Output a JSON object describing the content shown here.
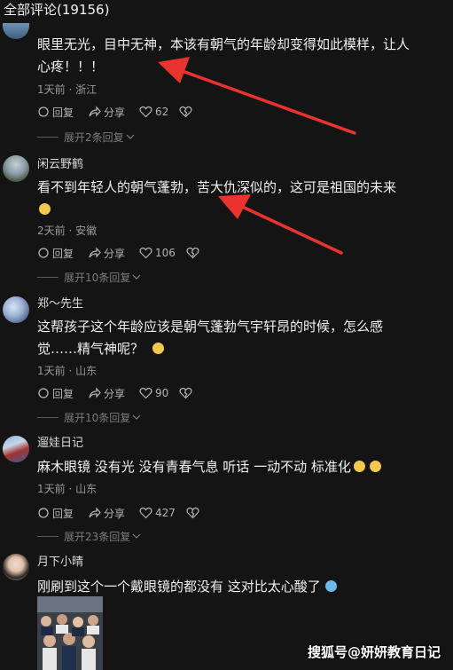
{
  "header": {
    "title": "全部评论(19156)"
  },
  "actions": {
    "reply_label": "回复",
    "share_label": "分享"
  },
  "comments": [
    {
      "username": "",
      "text_lines": [
        "眼里无光，目中无神，本该有朝气的年龄却变得如此模样，让人",
        "心疼！！！"
      ],
      "meta": "1天前 · 浙江",
      "likes": "62",
      "expand": "展开2条回复"
    },
    {
      "username": "闲云野鹤",
      "text_lines": [
        "看不到年轻人的朝气蓬勃，苦大仇深似的，这可是祖国的未来",
        ""
      ],
      "meta": "2天前 · 安徽",
      "likes": "106",
      "expand": "展开10条回复"
    },
    {
      "username": "郑～先生",
      "text_lines": [
        "这帮孩子这个年龄应该是朝气蓬勃气宇轩昂的时候，怎么感",
        "觉……精气神呢？"
      ],
      "meta": "1天前 · 山东",
      "likes": "90",
      "expand": "展开10条回复"
    },
    {
      "username": "遛娃日记",
      "text_lines": [
        "麻木眼镜 没有光 没有青春气息 听话 一动不动 标准化"
      ],
      "meta": "1天前 · 山东",
      "likes": "427",
      "expand": "展开23条回复"
    },
    {
      "username": "月下小晴",
      "text_lines": [
        "刚刷到这个一个戴眼镜的都没有 这对比太心酸了"
      ],
      "meta": "",
      "likes": "",
      "expand": ""
    }
  ],
  "watermark": "搜狐号@妍妍教育日记",
  "colors": {
    "background": "#141414",
    "arrow": "#e8332e",
    "text": "#f0f0f0",
    "meta": "#9a9a9a"
  }
}
